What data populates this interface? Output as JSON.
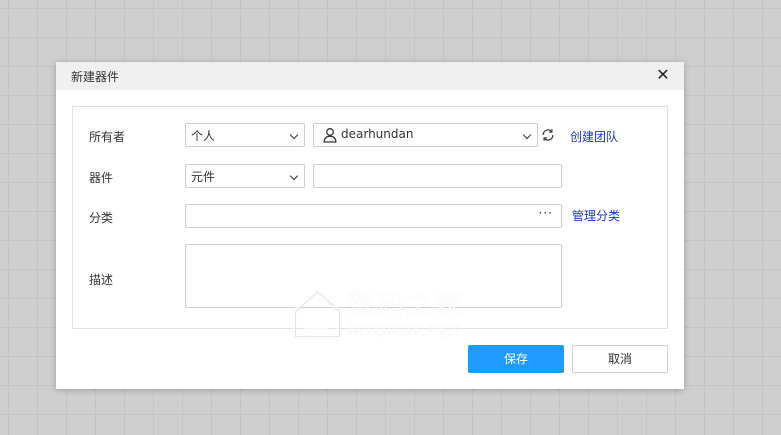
{
  "dialog": {
    "title": "新建器件",
    "close_label": "✕"
  },
  "form": {
    "owner": {
      "label": "所有者",
      "type_value": "个人",
      "user_value": "dearhundan",
      "create_team_link": "创建团队"
    },
    "device": {
      "label": "器件",
      "type_value": "元件",
      "name_value": ""
    },
    "category": {
      "label": "分类",
      "value": "",
      "more_label": "···",
      "manage_link": "管理分类"
    },
    "description": {
      "label": "描述",
      "value": ""
    }
  },
  "buttons": {
    "save": "保存",
    "cancel": "取消"
  },
  "watermark": {
    "cn": "数码之家",
    "en": "MYDIGIT.NET"
  },
  "colors": {
    "primary": "#1f9bff",
    "link": "#1b39c8",
    "header_bg": "#f0f0f0"
  }
}
